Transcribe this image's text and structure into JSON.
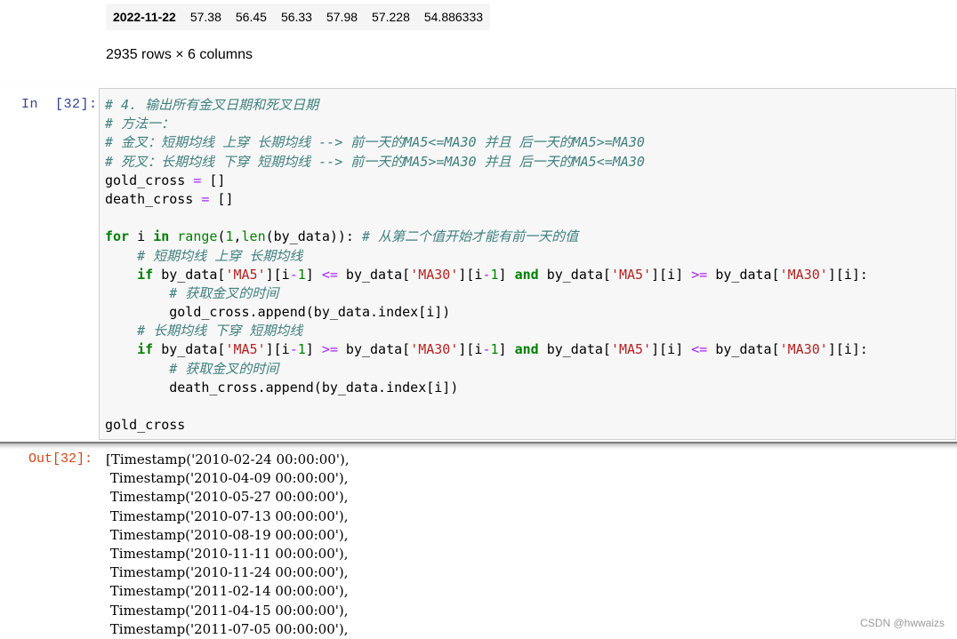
{
  "dataframe_tail": {
    "index": "2022-11-22",
    "values": [
      "57.38",
      "56.45",
      "56.33",
      "57.98",
      "57.228",
      "54.886333"
    ],
    "shape_text": "2935 rows × 6 columns"
  },
  "input_cell": {
    "prompt": "In  [32]:",
    "code_lines": [
      [
        {
          "t": "# 4. 输出所有金叉日期和死叉日期",
          "c": "cm"
        }
      ],
      [
        {
          "t": "# 方法一：",
          "c": "cm"
        }
      ],
      [
        {
          "t": "# 金叉：短期均线 上穿 长期均线 --> 前一天的MA5<=MA30 并且 后一天的MA5>=MA30",
          "c": "cm"
        }
      ],
      [
        {
          "t": "# 死叉：长期均线 下穿 短期均线 --> 前一天的MA5>=MA30 并且 后一天的MA5<=MA30",
          "c": "cm"
        }
      ],
      [
        {
          "t": "gold_cross ",
          "c": ""
        },
        {
          "t": "=",
          "c": "op"
        },
        {
          "t": " []",
          "c": ""
        }
      ],
      [
        {
          "t": "death_cross ",
          "c": ""
        },
        {
          "t": "=",
          "c": "op"
        },
        {
          "t": " []",
          "c": ""
        }
      ],
      [
        {
          "t": "",
          "c": ""
        }
      ],
      [
        {
          "t": "for",
          "c": "kw"
        },
        {
          "t": " i ",
          "c": ""
        },
        {
          "t": "in",
          "c": "kw"
        },
        {
          "t": " ",
          "c": ""
        },
        {
          "t": "range",
          "c": "bi"
        },
        {
          "t": "(",
          "c": ""
        },
        {
          "t": "1",
          "c": "num"
        },
        {
          "t": ",",
          "c": ""
        },
        {
          "t": "len",
          "c": "bi"
        },
        {
          "t": "(by_data)): ",
          "c": ""
        },
        {
          "t": "# 从第二个值开始才能有前一天的值",
          "c": "cm"
        }
      ],
      [
        {
          "t": "    ",
          "c": ""
        },
        {
          "t": "# 短期均线 上穿 长期均线",
          "c": "cm"
        }
      ],
      [
        {
          "t": "    ",
          "c": ""
        },
        {
          "t": "if",
          "c": "kw"
        },
        {
          "t": " by_data[",
          "c": ""
        },
        {
          "t": "'MA5'",
          "c": "str"
        },
        {
          "t": "][i",
          "c": ""
        },
        {
          "t": "-",
          "c": "op"
        },
        {
          "t": "1",
          "c": "num"
        },
        {
          "t": "] ",
          "c": ""
        },
        {
          "t": "<=",
          "c": "op"
        },
        {
          "t": " by_data[",
          "c": ""
        },
        {
          "t": "'MA30'",
          "c": "str"
        },
        {
          "t": "][i",
          "c": ""
        },
        {
          "t": "-",
          "c": "op"
        },
        {
          "t": "1",
          "c": "num"
        },
        {
          "t": "] ",
          "c": ""
        },
        {
          "t": "and",
          "c": "kw"
        },
        {
          "t": " by_data[",
          "c": ""
        },
        {
          "t": "'MA5'",
          "c": "str"
        },
        {
          "t": "][i] ",
          "c": ""
        },
        {
          "t": ">=",
          "c": "op"
        },
        {
          "t": " by_data[",
          "c": ""
        },
        {
          "t": "'MA30'",
          "c": "str"
        },
        {
          "t": "][i]:",
          "c": ""
        }
      ],
      [
        {
          "t": "        ",
          "c": ""
        },
        {
          "t": "# 获取金叉的时间",
          "c": "cm"
        }
      ],
      [
        {
          "t": "        gold_cross.append(by_data.index[i])",
          "c": ""
        }
      ],
      [
        {
          "t": "    ",
          "c": ""
        },
        {
          "t": "# 长期均线 下穿 短期均线",
          "c": "cm"
        }
      ],
      [
        {
          "t": "    ",
          "c": ""
        },
        {
          "t": "if",
          "c": "kw"
        },
        {
          "t": " by_data[",
          "c": ""
        },
        {
          "t": "'MA5'",
          "c": "str"
        },
        {
          "t": "][i",
          "c": ""
        },
        {
          "t": "-",
          "c": "op"
        },
        {
          "t": "1",
          "c": "num"
        },
        {
          "t": "] ",
          "c": ""
        },
        {
          "t": ">=",
          "c": "op"
        },
        {
          "t": " by_data[",
          "c": ""
        },
        {
          "t": "'MA30'",
          "c": "str"
        },
        {
          "t": "][i",
          "c": ""
        },
        {
          "t": "-",
          "c": "op"
        },
        {
          "t": "1",
          "c": "num"
        },
        {
          "t": "] ",
          "c": ""
        },
        {
          "t": "and",
          "c": "kw"
        },
        {
          "t": " by_data[",
          "c": ""
        },
        {
          "t": "'MA5'",
          "c": "str"
        },
        {
          "t": "][i] ",
          "c": ""
        },
        {
          "t": "<=",
          "c": "op"
        },
        {
          "t": " by_data[",
          "c": ""
        },
        {
          "t": "'MA30'",
          "c": "str"
        },
        {
          "t": "][i]:",
          "c": ""
        }
      ],
      [
        {
          "t": "        ",
          "c": ""
        },
        {
          "t": "# 获取金叉的时间",
          "c": "cm"
        }
      ],
      [
        {
          "t": "        death_cross.append(by_data.index[i])",
          "c": ""
        }
      ],
      [
        {
          "t": "",
          "c": ""
        }
      ],
      [
        {
          "t": "gold_cross",
          "c": ""
        }
      ]
    ]
  },
  "output_cell": {
    "prompt": "Out[32]:",
    "lines": [
      "[Timestamp('2010-02-24 00:00:00'),",
      " Timestamp('2010-04-09 00:00:00'),",
      " Timestamp('2010-05-27 00:00:00'),",
      " Timestamp('2010-07-13 00:00:00'),",
      " Timestamp('2010-08-19 00:00:00'),",
      " Timestamp('2010-11-11 00:00:00'),",
      " Timestamp('2010-11-24 00:00:00'),",
      " Timestamp('2011-02-14 00:00:00'),",
      " Timestamp('2011-04-15 00:00:00'),",
      " Timestamp('2011-07-05 00:00:00'),"
    ]
  },
  "watermark": "CSDN @hwwaizs"
}
